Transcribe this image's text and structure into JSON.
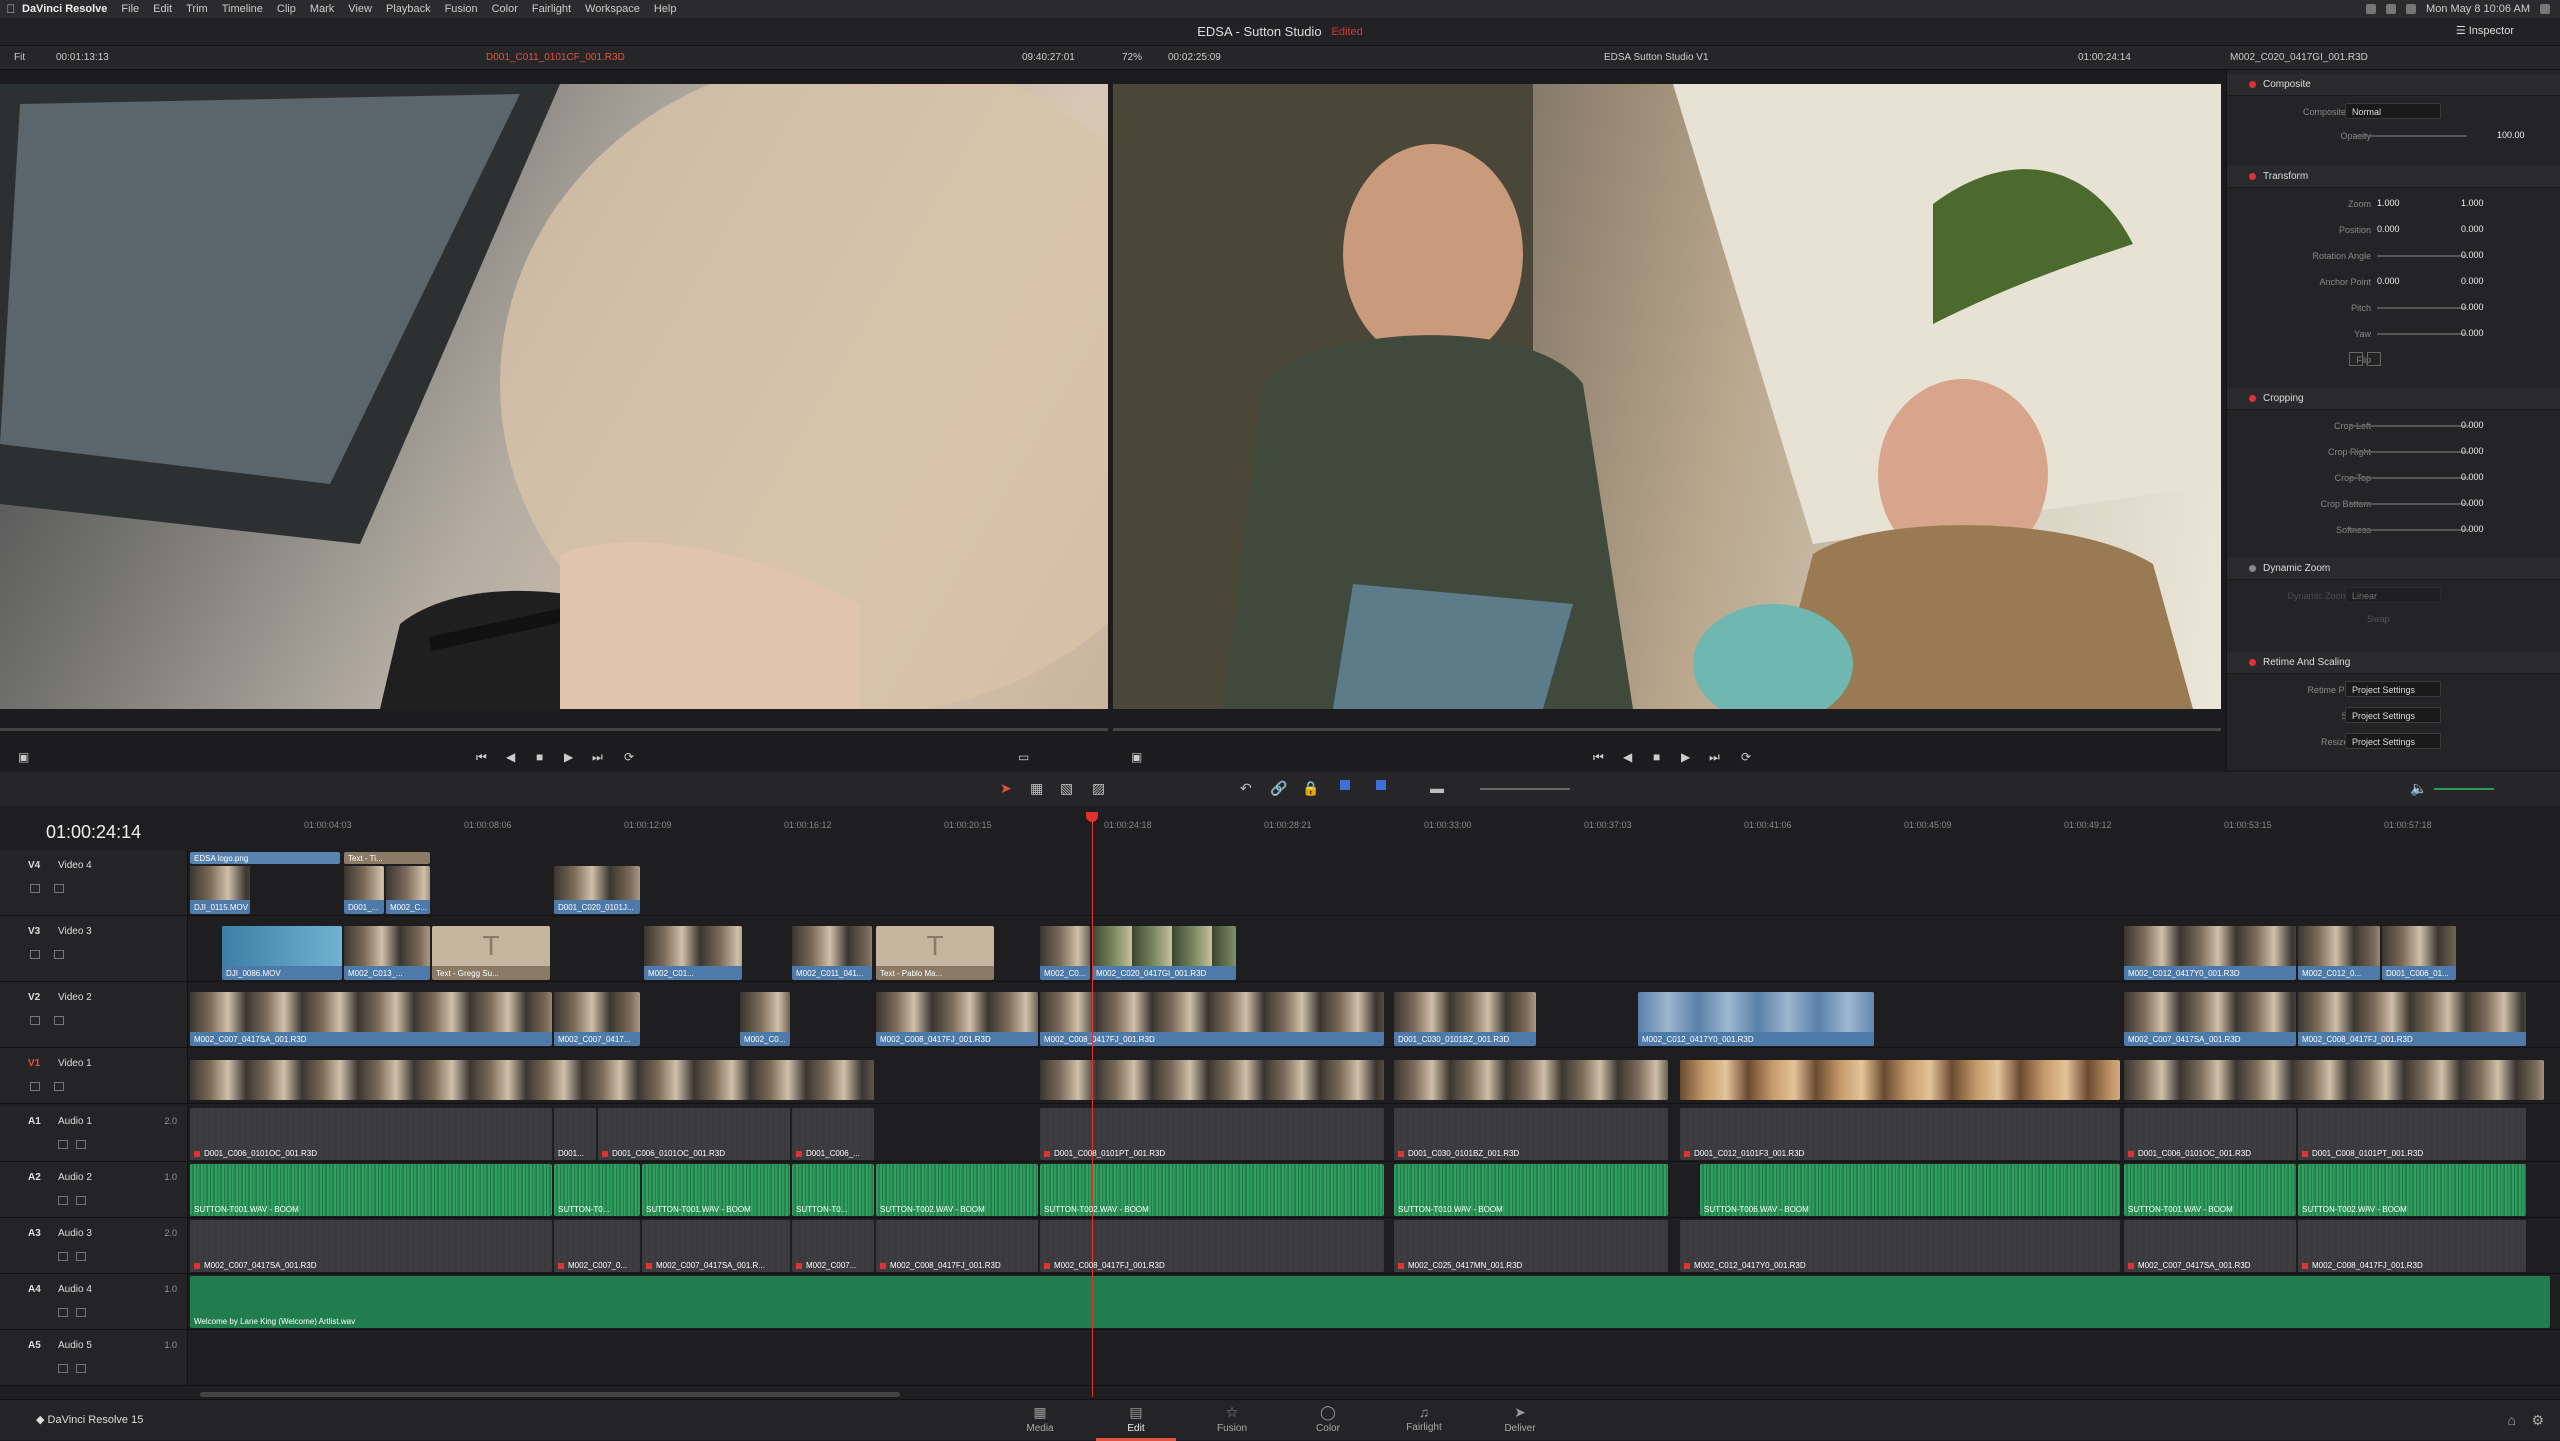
{
  "menubar": {
    "app_name": "DaVinci Resolve",
    "items": [
      "File",
      "Edit",
      "Trim",
      "Timeline",
      "Clip",
      "Mark",
      "View",
      "Playback",
      "Fusion",
      "Color",
      "Fairlight",
      "Workspace",
      "Help"
    ],
    "clock": "Mon May 8 10:06 AM"
  },
  "window": {
    "project_title": "EDSA - Sutton Studio",
    "edited_label": "Edited",
    "inspector_label": "Inspector"
  },
  "source_viewer": {
    "fit_label": "Fit",
    "timecode": "00:01:13:13",
    "clip_name": "D001_C011_0101CF_001.R3D",
    "duration": "09:40:27:01"
  },
  "record_viewer": {
    "zoom": "72%",
    "timecode": "00:02:25:09",
    "timeline_name": "EDSA Sutton Studio V1",
    "current_tc": "01:00:24:14",
    "clip_name": "M002_C020_0417GI_001.R3D"
  },
  "inspector": {
    "composite": {
      "title": "Composite",
      "mode_label": "Composite Mode",
      "mode_value": "Normal",
      "opacity_label": "Opacity",
      "opacity_value": "100.00"
    },
    "transform": {
      "title": "Transform",
      "zoom_label": "Zoom",
      "zoom_x": "1.000",
      "zoom_y": "1.000",
      "position_label": "Position",
      "position_x": "0.000",
      "position_y": "0.000",
      "rotation_label": "Rotation Angle",
      "rotation_value": "0.000",
      "anchor_label": "Anchor Point",
      "anchor_x": "0.000",
      "anchor_y": "0.000",
      "pitch_label": "Pitch",
      "pitch_value": "0.000",
      "yaw_label": "Yaw",
      "yaw_value": "0.000",
      "flip_label": "Flip"
    },
    "cropping": {
      "title": "Cropping",
      "crop_left_label": "Crop Left",
      "crop_left": "0.000",
      "crop_right_label": "Crop Right",
      "crop_right": "0.000",
      "crop_top_label": "Crop Top",
      "crop_top": "0.000",
      "crop_bottom_label": "Crop Bottom",
      "crop_bottom": "0.000",
      "softness_label": "Softness",
      "softness": "0.000"
    },
    "dynamic_zoom": {
      "title": "Dynamic Zoom",
      "ease_label": "Dynamic Zoom Ease",
      "ease_value": "Linear",
      "swap_label": "Swap"
    },
    "retime": {
      "title": "Retime And Scaling",
      "process_label": "Retime Process",
      "process_value": "Project Settings",
      "scaling_label": "Scaling",
      "scaling_value": "Project Settings",
      "filter_label": "Resize Filter",
      "filter_value": "Project Settings"
    }
  },
  "timeline": {
    "timecode": "01:00:24:14",
    "ruler": [
      "01:00:04:03",
      "01:00:08:06",
      "01:00:12:09",
      "01:00:16:12",
      "01:00:20:15",
      "01:00:24:18",
      "01:00:28:21",
      "01:00:33:00",
      "01:00:37:03",
      "01:00:41:06",
      "01:00:45:09",
      "01:00:49:12",
      "01:00:53:15",
      "01:00:57:18"
    ],
    "tracks": {
      "v4": {
        "id": "V4",
        "name": "Video 4"
      },
      "v3": {
        "id": "V3",
        "name": "Video 3"
      },
      "v2": {
        "id": "V2",
        "name": "Video 2"
      },
      "v1": {
        "id": "V1",
        "name": "Video 1"
      },
      "a1": {
        "id": "A1",
        "name": "Audio 1",
        "db": "2.0"
      },
      "a2": {
        "id": "A2",
        "name": "Audio 2",
        "db": "1.0"
      },
      "a3": {
        "id": "A3",
        "name": "Audio 3",
        "db": "2.0"
      },
      "a4": {
        "id": "A4",
        "name": "Audio 4",
        "db": "1.0"
      },
      "a5": {
        "id": "A5",
        "name": "Audio 5",
        "db": "1.0"
      }
    },
    "clips": {
      "v4_1": "EDSA logo.png",
      "v4_2": "DJI_0115.MOV",
      "v4_3": "Text - Ti...",
      "v4_4": "D001_...",
      "v4_5": "M002_C...",
      "v4_6": "D001_C020_0101J...",
      "v3_1": "DJI_0086.MOV",
      "v3_2": "M002_C013_...",
      "v3_3": "Text - Gregg Su...",
      "v3_4": "M002_C01...",
      "v3_5": "M002_C011_041...",
      "v3_6": "Text - Pablo Ma...",
      "v3_7": "M002_C0...",
      "v3_8": "M002_C020_0417GI_001.R3D",
      "v3_9": "M002_C012_0417Y0_001.R3D",
      "v3_10": "M002_C012_0...",
      "v3_11": "D001_C006_01...",
      "v2_1": "M002_C007_0417SA_001.R3D",
      "v2_2": "M002_C007_0417...",
      "v2_3": "M002_C0...",
      "v2_4": "M002_C008_0417FJ_001.R3D",
      "v2_5": "M002_C008_0417FJ_001.R3D",
      "v2_6": "D001_C030_0101BZ_001.R3D",
      "v2_7": "M002_C012_0417Y0_001.R3D",
      "v2_8": "M002_C007_0417SA_001.R3D",
      "v2_9": "M002_C008_0417FJ_001.R3D",
      "a1_1": "D001_C006_0101OC_001.R3D",
      "a1_2": "D001...",
      "a1_3": "D001_C006_0101OC_001.R3D",
      "a1_4": "D001_C006_...",
      "a1_5": "D001_C008_0101PT_001.R3D",
      "a1_6": "D001_C030_0101BZ_001.R3D",
      "a1_7": "D001_C012_0101F3_001.R3D",
      "a1_8": "D001_C006_0101OC_001.R3D",
      "a1_9": "D001_C008_0101PT_001.R3D",
      "a2_1": "SUTTON-T001.WAV - BOOM",
      "a2_2": "SUTTON-T0...",
      "a2_3": "SUTTON-T001.WAV - BOOM",
      "a2_4": "SUTTON-T0...",
      "a2_5": "SUTTON-T002.WAV - BOOM",
      "a2_6": "SUTTON-T002.WAV - BOOM",
      "a2_7": "SUTTON-T010.WAV - BOOM",
      "a2_8": "SUTTON-T006.WAV - BOOM",
      "a2_9": "SUTTON-T001.WAV - BOOM",
      "a2_10": "SUTTON-T002.WAV - BOOM",
      "a3_1": "M002_C007_0417SA_001.R3D",
      "a3_2": "M002_C007_0...",
      "a3_3": "M002_C007_0417SA_001.R...",
      "a3_4": "M002_C007...",
      "a3_5": "M002_C008_0417FJ_001.R3D",
      "a3_6": "M002_C008_0417FJ_001.R3D",
      "a3_7": "M002_C025_0417MN_001.R3D",
      "a3_8": "M002_C012_0417Y0_001.R3D",
      "a3_9": "M002_C007_0417SA_001.R3D",
      "a3_10": "M002_C008_0417FJ_001.R3D",
      "a4_1": "Welcome by Lane King (Welcome) Artlist.wav"
    }
  },
  "bottombar": {
    "app_version": "DaVinci Resolve 15",
    "pages": [
      "Media",
      "Edit",
      "Fusion",
      "Color",
      "Fairlight",
      "Deliver"
    ],
    "active_page": "Edit"
  }
}
